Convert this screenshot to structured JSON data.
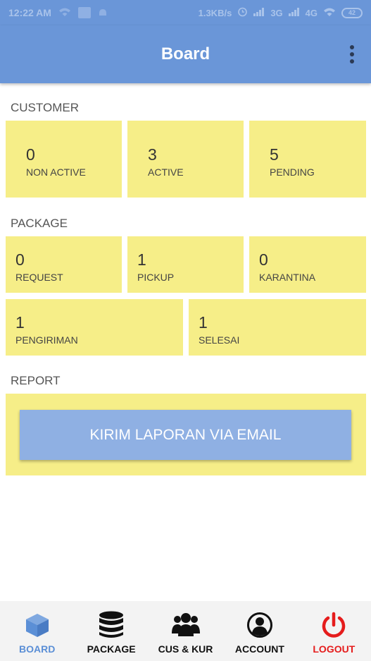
{
  "status_bar": {
    "time": "12:22 AM",
    "net_speed": "1.3KB/s",
    "network_3g": "3G",
    "network_4g": "4G",
    "battery": "42"
  },
  "app_bar": {
    "title": "Board"
  },
  "customer": {
    "section_label": "CUSTOMER",
    "tiles": [
      {
        "value": "0",
        "label": "NON ACTIVE"
      },
      {
        "value": "3",
        "label": "ACTIVE"
      },
      {
        "value": "5",
        "label": "PENDING"
      }
    ]
  },
  "package": {
    "section_label": "PACKAGE",
    "tiles": [
      {
        "value": "0",
        "label": "REQUEST"
      },
      {
        "value": "1",
        "label": "PICKUP"
      },
      {
        "value": "0",
        "label": "KARANTINA"
      },
      {
        "value": "1",
        "label": "PENGIRIMAN"
      },
      {
        "value": "1",
        "label": "SELESAI"
      }
    ]
  },
  "report": {
    "section_label": "REPORT",
    "button_label": "KIRIM LAPORAN VIA EMAIL"
  },
  "bottom_nav": {
    "items": [
      {
        "label": "BOARD",
        "icon": "box-icon",
        "active": true
      },
      {
        "label": "PACKAGE",
        "icon": "database-icon"
      },
      {
        "label": "CUS & KUR",
        "icon": "users-icon"
      },
      {
        "label": "ACCOUNT",
        "icon": "account-icon"
      },
      {
        "label": "LOGOUT",
        "icon": "power-icon"
      }
    ]
  },
  "colors": {
    "primary": "#6a96d8",
    "tile_bg": "#f6ee88",
    "button_bg": "#8fb0e3",
    "active_nav": "#5b8fd6",
    "logout": "#e51c1c"
  }
}
